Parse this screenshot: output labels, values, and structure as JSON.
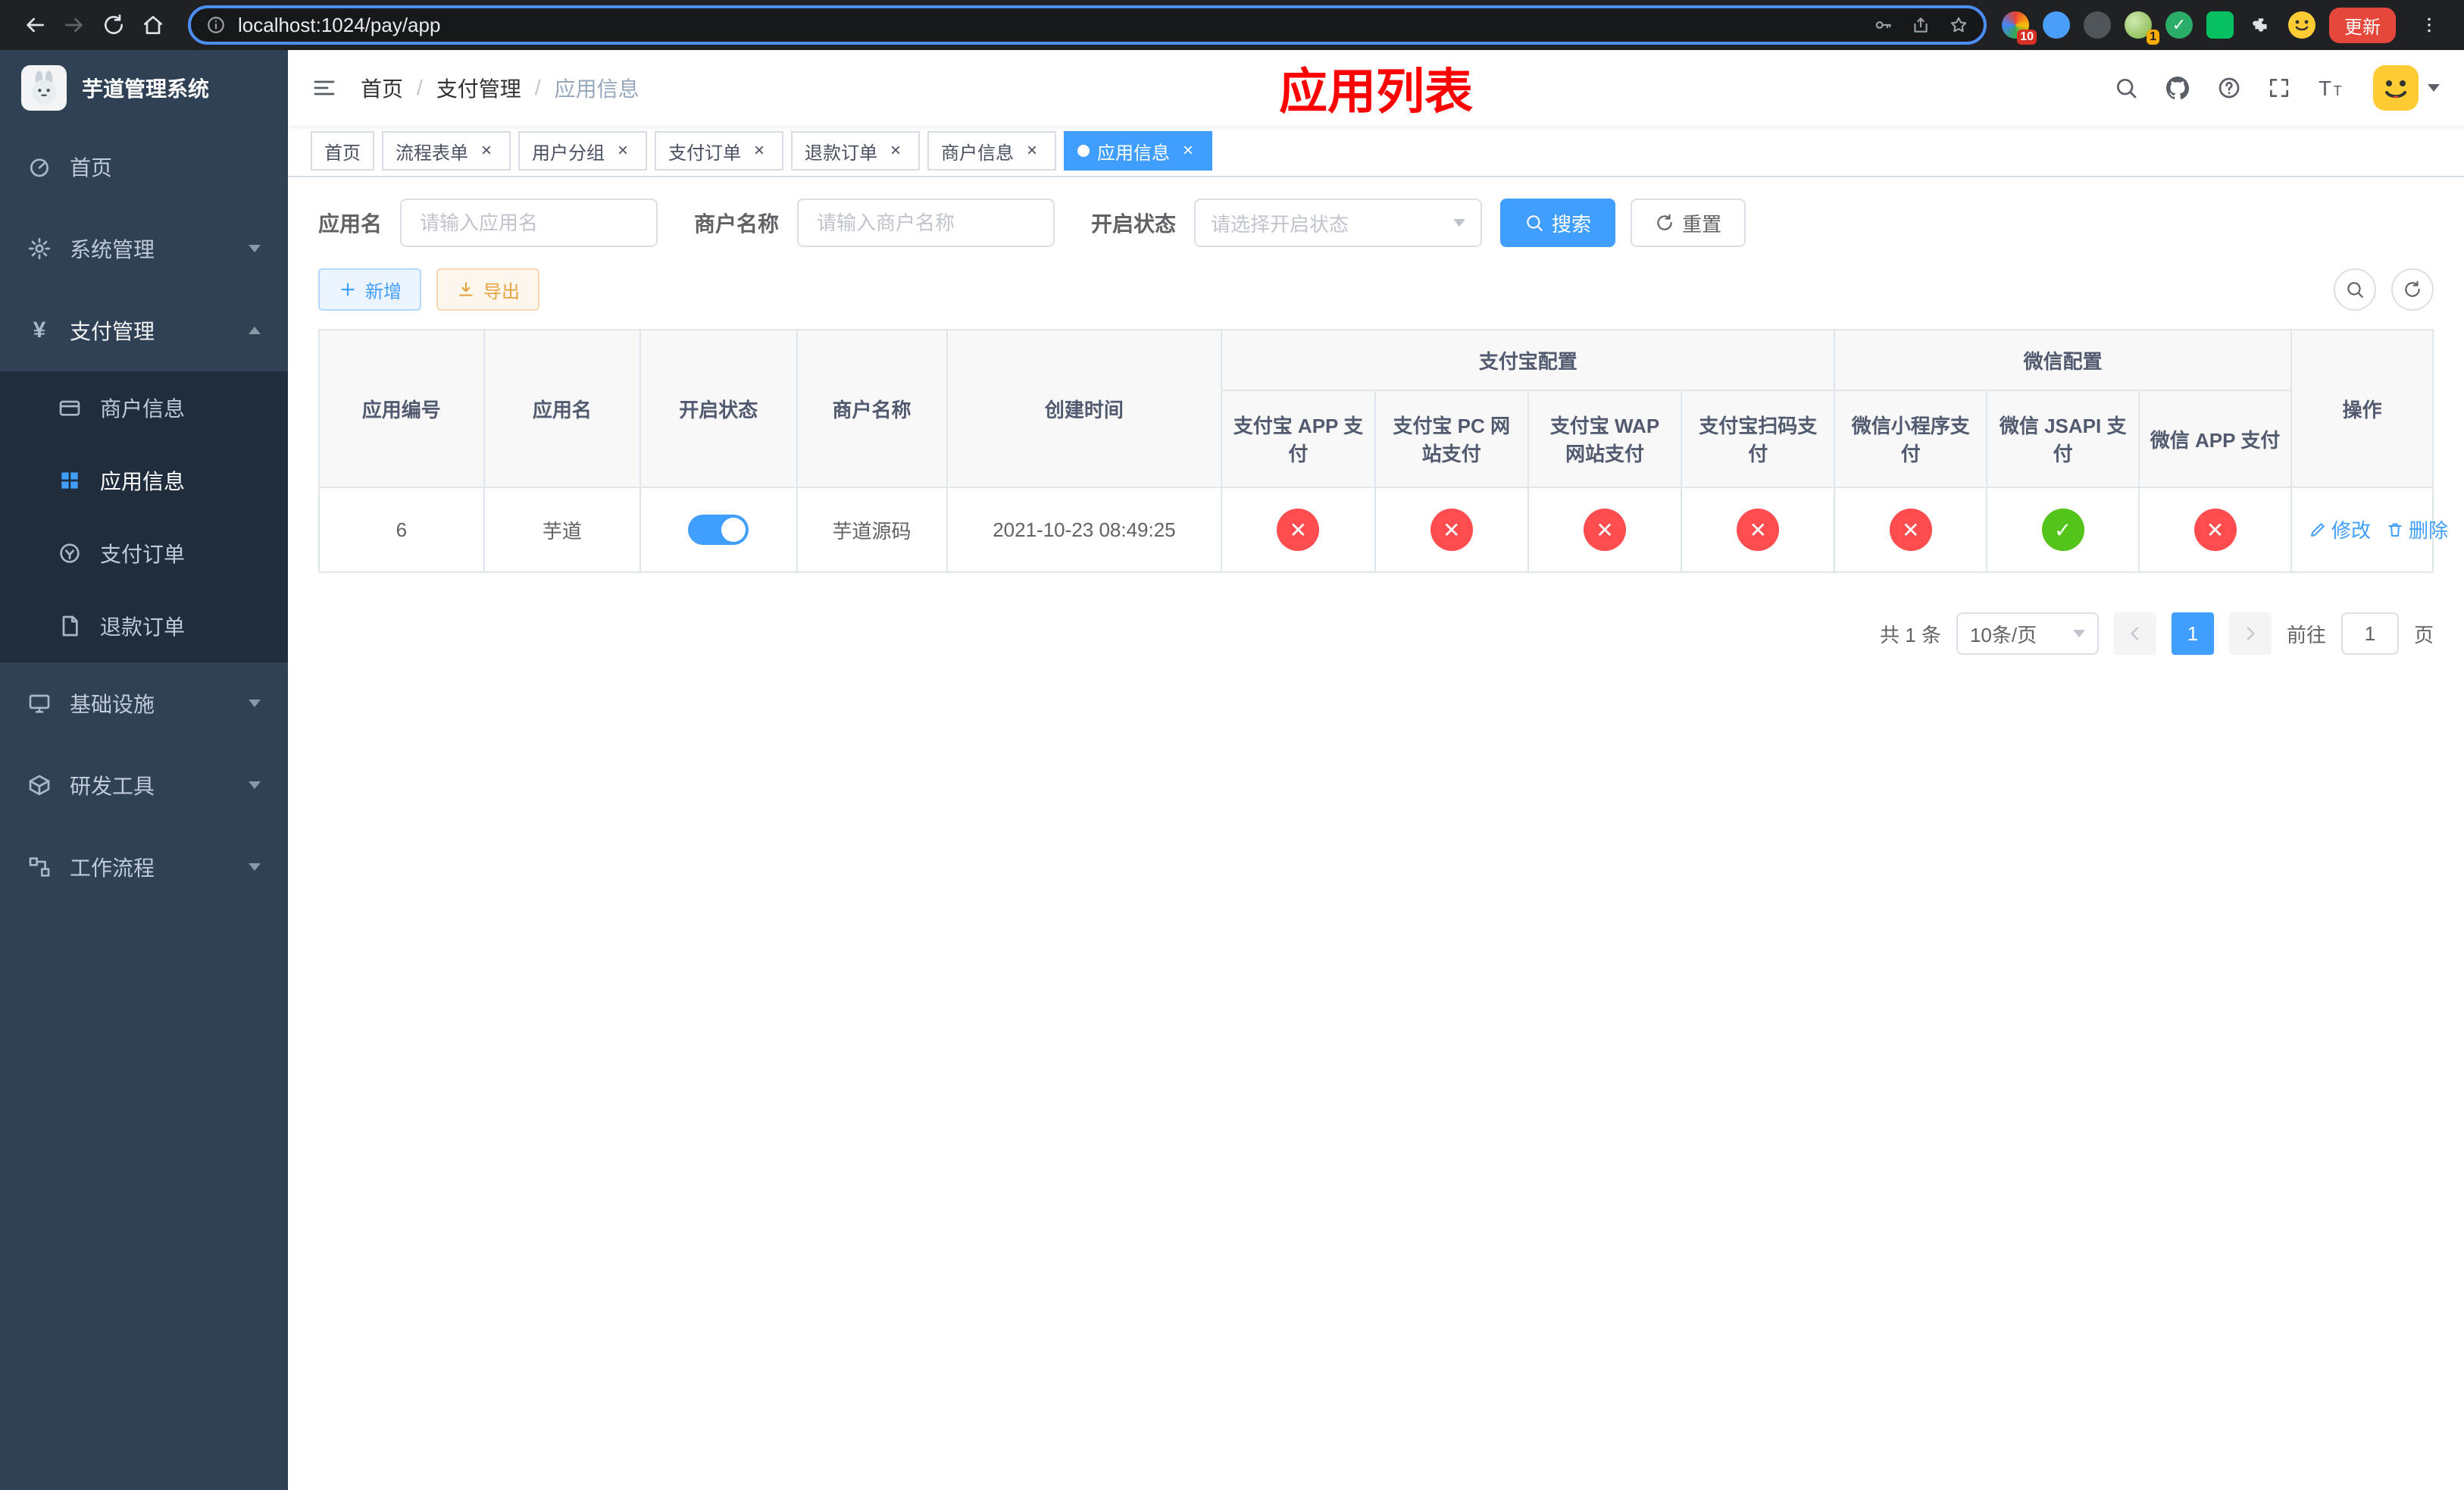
{
  "browser": {
    "url": "localhost:1024/pay/app",
    "update_label": "更新",
    "extension_badge_1": "10",
    "extension_badge_2": "1"
  },
  "sidebar": {
    "title": "芋道管理系统",
    "items": [
      {
        "label": "首页"
      },
      {
        "label": "系统管理"
      },
      {
        "label": "支付管理",
        "children": [
          {
            "label": "商户信息"
          },
          {
            "label": "应用信息"
          },
          {
            "label": "支付订单"
          },
          {
            "label": "退款订单"
          }
        ]
      },
      {
        "label": "基础设施"
      },
      {
        "label": "研发工具"
      },
      {
        "label": "工作流程"
      }
    ]
  },
  "header": {
    "breadcrumb": [
      "首页",
      "支付管理",
      "应用信息"
    ],
    "page_title": "应用列表"
  },
  "tabs": [
    {
      "label": "首页"
    },
    {
      "label": "流程表单"
    },
    {
      "label": "用户分组"
    },
    {
      "label": "支付订单"
    },
    {
      "label": "退款订单"
    },
    {
      "label": "商户信息"
    },
    {
      "label": "应用信息"
    }
  ],
  "filters": {
    "app_name_label": "应用名",
    "app_name_placeholder": "请输入应用名",
    "merchant_label": "商户名称",
    "merchant_placeholder": "请输入商户名称",
    "status_label": "开启状态",
    "status_placeholder": "请选择开启状态",
    "search_label": "搜索",
    "reset_label": "重置"
  },
  "toolbar": {
    "add_label": "新增",
    "export_label": "导出"
  },
  "table": {
    "columns": [
      "应用编号",
      "应用名",
      "开启状态",
      "商户名称",
      "创建时间"
    ],
    "groups": [
      {
        "label": "支付宝配置",
        "children": [
          "支付宝 APP 支付",
          "支付宝 PC 网站支付",
          "支付宝 WAP 网站支付",
          "支付宝扫码支付"
        ]
      },
      {
        "label": "微信配置",
        "children": [
          "微信小程序支付",
          "微信 JSAPI 支付",
          "微信 APP 支付"
        ]
      }
    ],
    "op_column": "操作",
    "status_icons": {
      "ok": "✓",
      "fail": "✕"
    },
    "row": {
      "id": "6",
      "name": "芋道",
      "enabled": true,
      "merchant": "芋道源码",
      "created": "2021-10-23 08:49:25",
      "statuses": [
        false,
        false,
        false,
        false,
        false,
        true,
        false
      ],
      "edit_label": "修改",
      "delete_label": "删除"
    }
  },
  "pagination": {
    "total": "共 1 条",
    "page_size": "10条/页",
    "current_page": "1",
    "goto_prefix": "前往",
    "goto_value": "1",
    "goto_suffix": "页"
  },
  "colors": {
    "primary": "#409eff",
    "success": "#52c41a",
    "danger": "#ff4d4f",
    "warning": "#e6a23c",
    "sidebar_bg": "#304156",
    "submenu_bg": "#1f2d3d",
    "title_red": "#ff0000"
  }
}
